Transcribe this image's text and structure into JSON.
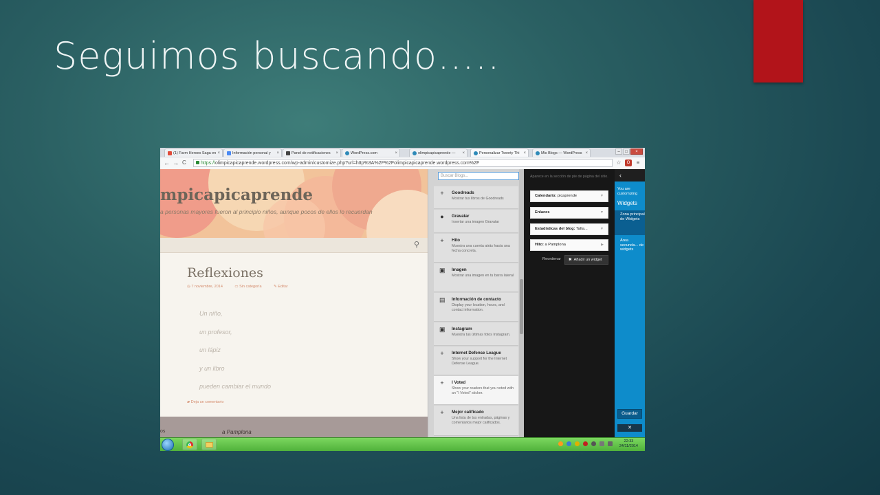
{
  "slide": {
    "title": "Seguimos buscando…..",
    "colors": {
      "background": "#1f4f58",
      "accent_bar": "#b2141a"
    }
  },
  "browser": {
    "tabs": [
      {
        "label": "(1) Farm Heroes Saga en",
        "icon": "farm-heroes-icon"
      },
      {
        "label": "Información personal y",
        "icon": "google-icon"
      },
      {
        "label": "Panel de notificaciones",
        "icon": "notifications-icon"
      },
      {
        "label": "WordPress.com",
        "icon": "wordpress-icon"
      },
      {
        "label": "olimpicapicaprende —",
        "icon": "wordpress-icon"
      },
      {
        "label": "Personalizar Twenty Thi",
        "icon": "wordpress-icon"
      },
      {
        "label": "Mis Blogs — WordPress",
        "icon": "wordpress-icon"
      }
    ],
    "tab_close": "×",
    "url": {
      "protocol": "https://",
      "rest": "olimpicapicaprende.wordpress.com/wp-admin/customize.php?url=http%3A%2F%2Folimpicapicaprende.wordpress.com%2F"
    },
    "nav": {
      "back": "←",
      "forward": "→",
      "reload": "C"
    },
    "window_controls": {
      "minimize": "–",
      "maximize": "□",
      "close": "×"
    }
  },
  "site": {
    "title": "mpicapicaprende",
    "description": "a personas mayores fueron al principio niños, aunque pocos de ellos lo recuerdan",
    "post_title": "Reflexiones",
    "meta": {
      "date": "7 noviembre, 2014",
      "category": "Sin categoría",
      "edit": "Editar"
    },
    "verses": [
      "Un niño,",
      "un profesor,",
      "un lápiz",
      "y un libro",
      "pueden cambiar el mundo"
    ],
    "comments": "Deja un comentario",
    "footer_left": "os",
    "footer_text": "a Pamplona"
  },
  "widget_list": {
    "search_placeholder": "Buscar Blogs...",
    "items": [
      {
        "name": "Goodreads",
        "desc": "Mostrar tus libros de Goodreads",
        "icon": "plus-icon"
      },
      {
        "name": "Gravatar",
        "desc": "Insertar una imagen Gravatar",
        "icon": "person-icon"
      },
      {
        "name": "Hito",
        "desc": "Muestra una cuenta atrás hasta una fecha concreta.",
        "icon": "plus-icon"
      },
      {
        "name": "Imagen",
        "desc": "Mostrar una imagen en tu barra lateral",
        "icon": "image-icon"
      },
      {
        "name": "Información de contacto",
        "desc": "Display your location, hours, and contact information.",
        "icon": "contact-icon"
      },
      {
        "name": "Instagram",
        "desc": "Muestra tus últimas fotos Instagram.",
        "icon": "image-icon"
      },
      {
        "name": "Internet Defense League",
        "desc": "Show your support for the Internet Defense League.",
        "icon": "plus-icon"
      },
      {
        "name": "I Voted",
        "desc": "Show your readers that you voted with an \"I Voted\" sticker.",
        "icon": "plus-icon"
      },
      {
        "name": "Mejor calificado",
        "desc": "Una lista de tus entradas, páginas y comentarios mejor calificados.",
        "icon": "plus-icon"
      }
    ]
  },
  "widget_area": {
    "description": "Aparece en la sección de pie de página del sitio.",
    "widgets": [
      {
        "title": "Calendario:",
        "sub": "picaprende"
      },
      {
        "title": "Enlaces",
        "sub": ""
      },
      {
        "title": "Estadísticas del blog:",
        "sub": "Talta..."
      },
      {
        "title": "Hito:",
        "sub": "a Pamplona"
      }
    ],
    "reorder": "Reordenar",
    "add_widget": "Añadir un widget",
    "add_icon": "✖"
  },
  "customizer": {
    "back": "‹",
    "label_small": "You are customizing",
    "label_big": "Widgets",
    "sections": [
      {
        "label": "Zona principal de Widgets",
        "active": true
      },
      {
        "label": "Área secunda... de widgets",
        "active": false
      }
    ],
    "save": "Guardar",
    "close": "✕"
  },
  "taskbar": {
    "time": "22:33",
    "date": "24/11/2014"
  }
}
